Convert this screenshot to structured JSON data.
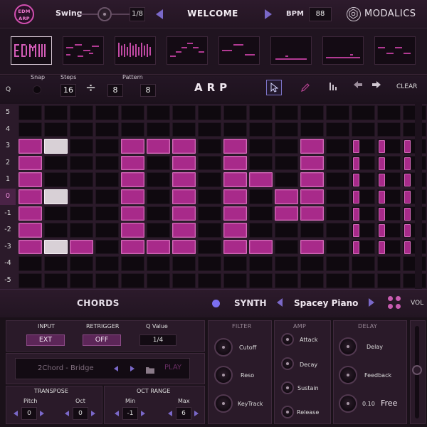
{
  "topbar": {
    "logo_text": "EDM ARP",
    "swing_label": "Swing",
    "swing_value": "1/8",
    "preset_name": "WELCOME",
    "bpm_label": "BPM",
    "bpm_value": "88",
    "brand": "MODALICS"
  },
  "thumbnails": {
    "count": 8,
    "active_index": 0
  },
  "toolbar": {
    "q_label": "Q",
    "snap_label": "Snap",
    "steps_label": "Steps",
    "steps_value": "16",
    "divide_symbol": "÷",
    "division_value": "8",
    "pattern_label": "Pattern",
    "pattern_value": "8",
    "title": "ARP",
    "clear_label": "CLEAR",
    "icons": [
      "cursor-icon",
      "pencil-icon",
      "bars-icon",
      "undo-arrow-icon",
      "redo-arrow-icon"
    ]
  },
  "grid": {
    "row_labels": [
      "5",
      "4",
      "3",
      "2",
      "1",
      "0",
      "-1",
      "-2",
      "-3",
      "-4",
      "-5"
    ],
    "highlight_row": "0",
    "columns": 15,
    "active_cells": [
      [
        2,
        0
      ],
      [
        2,
        4
      ],
      [
        2,
        5
      ],
      [
        2,
        6
      ],
      [
        2,
        8
      ],
      [
        2,
        11
      ],
      [
        3,
        0
      ],
      [
        3,
        4
      ],
      [
        3,
        6
      ],
      [
        3,
        8
      ],
      [
        3,
        11
      ],
      [
        4,
        0
      ],
      [
        4,
        4
      ],
      [
        4,
        6
      ],
      [
        4,
        8
      ],
      [
        4,
        9
      ],
      [
        4,
        11
      ],
      [
        5,
        0
      ],
      [
        5,
        4
      ],
      [
        5,
        6
      ],
      [
        5,
        8
      ],
      [
        5,
        10
      ],
      [
        5,
        11
      ],
      [
        6,
        0
      ],
      [
        6,
        4
      ],
      [
        6,
        6
      ],
      [
        6,
        8
      ],
      [
        6,
        10
      ],
      [
        6,
        11
      ],
      [
        7,
        0
      ],
      [
        7,
        4
      ],
      [
        7,
        6
      ],
      [
        7,
        8
      ],
      [
        8,
        0
      ],
      [
        8,
        2
      ],
      [
        8,
        4
      ],
      [
        8,
        5
      ],
      [
        8,
        6
      ],
      [
        8,
        8
      ],
      [
        8,
        9
      ],
      [
        8,
        11
      ]
    ],
    "ghost_cells": [
      [
        2,
        1
      ],
      [
        5,
        1
      ],
      [
        8,
        1
      ]
    ],
    "thin_cells": [
      [
        2,
        13
      ],
      [
        2,
        14
      ],
      [
        2,
        15
      ],
      [
        3,
        13
      ],
      [
        3,
        14
      ],
      [
        3,
        15
      ],
      [
        4,
        13
      ],
      [
        4,
        14
      ],
      [
        4,
        15
      ],
      [
        5,
        13
      ],
      [
        5,
        14
      ],
      [
        5,
        15
      ],
      [
        6,
        13
      ],
      [
        6,
        14
      ],
      [
        6,
        15
      ],
      [
        7,
        13
      ],
      [
        7,
        14
      ],
      [
        7,
        15
      ],
      [
        8,
        13
      ],
      [
        8,
        14
      ],
      [
        8,
        15
      ]
    ]
  },
  "synth_bar": {
    "chords_label": "CHORDS",
    "synth_label": "SYNTH",
    "synth_preset": "Spacey Piano",
    "vol_label": "VOL"
  },
  "chords": {
    "input_label": "INPUT",
    "input_value": "EXT",
    "retrigger_label": "RETRIGGER",
    "retrigger_value": "OFF",
    "q_value_label": "Q Value",
    "q_value": "1/4",
    "chord_preset": "2Chord - Bridge",
    "play_label": "PLAY",
    "transpose_label": "TRANSPOSE",
    "pitch_label": "Pitch",
    "pitch_value": "0",
    "oct_label": "Oct",
    "oct_value": "0",
    "oct_range_label": "OCT RANGE",
    "min_label": "Min",
    "min_value": "-1",
    "max_label": "Max",
    "max_value": "6"
  },
  "filter": {
    "title": "FILTER",
    "knobs": [
      "Cutoff",
      "Reso",
      "KeyTrack"
    ]
  },
  "amp": {
    "title": "AMP",
    "knobs": [
      "Attack",
      "Decay",
      "Sustain",
      "Release"
    ]
  },
  "delay": {
    "title": "DELAY",
    "knobs": [
      "Delay",
      "Feedback"
    ],
    "value": "0.10",
    "mode": "Free"
  },
  "colors": {
    "accent": "#a82a8a",
    "accent_light": "#d26ab8",
    "arrow": "#7a68c8",
    "background": "#1a1119"
  }
}
